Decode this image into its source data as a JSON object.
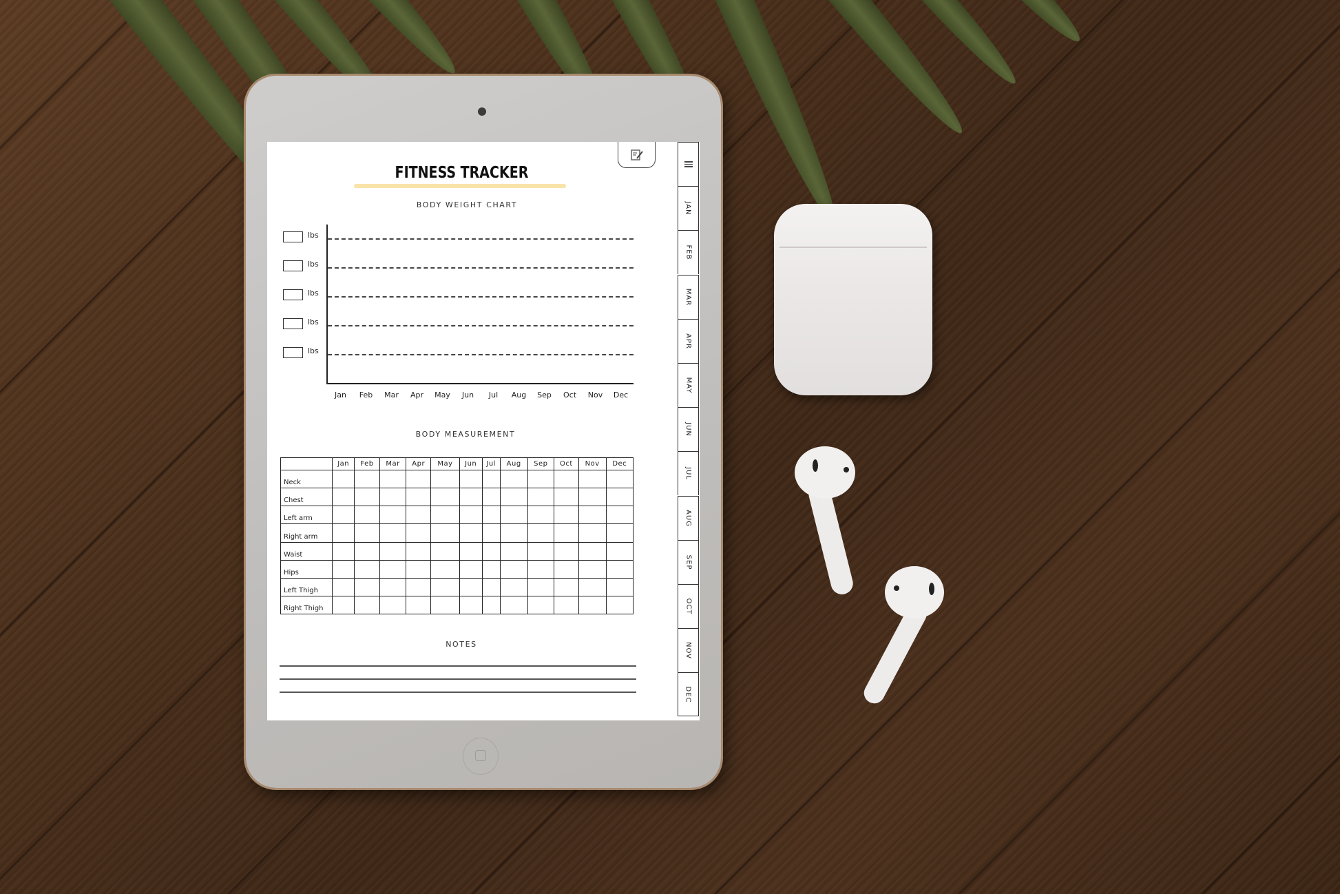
{
  "app": {
    "title": "FITNESS TRACKER",
    "accent_color": "#f8e3a8"
  },
  "toolbar": {
    "edit_icon": "edit-note-icon",
    "menu_icon": "menu-icon"
  },
  "tabs": [
    "JAN",
    "FEB",
    "MAR",
    "APR",
    "MAY",
    "JUN",
    "JUL",
    "AUG",
    "SEP",
    "OCT",
    "NOV",
    "DEC"
  ],
  "body_weight_chart": {
    "title": "BODY WEIGHT CHART",
    "unit_label": "lbs",
    "weight_inputs": [
      "",
      "",
      "",
      "",
      ""
    ],
    "months": [
      "Jan",
      "Feb",
      "Mar",
      "Apr",
      "May",
      "Jun",
      "Jul",
      "Aug",
      "Sep",
      "Oct",
      "Nov",
      "Dec"
    ]
  },
  "body_measurement": {
    "title": "BODY MEASUREMENT",
    "columns": [
      "",
      "Jan",
      "Feb",
      "Mar",
      "Apr",
      "May",
      "Jun",
      "Jul",
      "Aug",
      "Sep",
      "Oct",
      "Nov",
      "Dec"
    ],
    "rows": [
      "Neck",
      "Chest",
      "Left arm",
      "Right arm",
      "Waist",
      "Hips",
      "Left Thigh",
      "Right Thigh"
    ]
  },
  "notes": {
    "title": "NOTES",
    "lines": [
      "",
      "",
      ""
    ]
  }
}
